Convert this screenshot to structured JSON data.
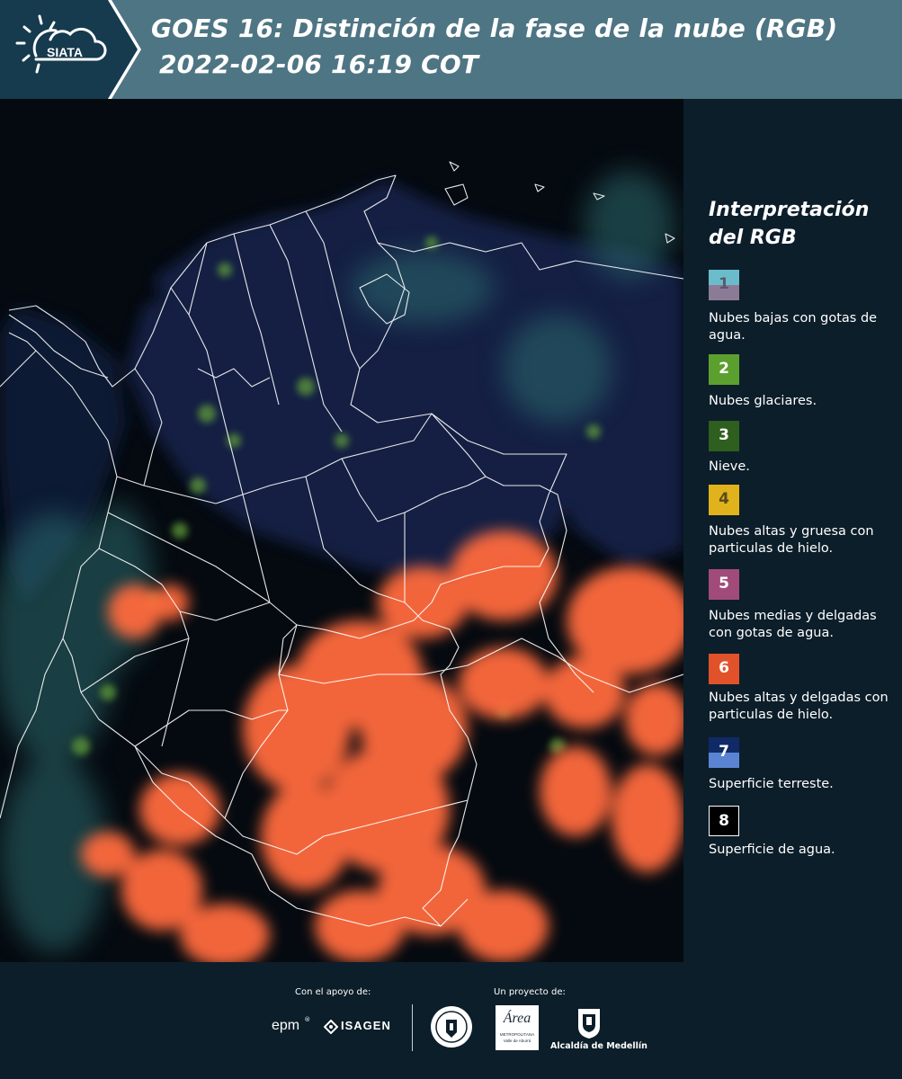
{
  "header": {
    "logo_text": "SIATA",
    "title": "GOES 16: Distinción de la fase de la nube (RGB)",
    "subtitle": "2022-02-06 16:19 COT"
  },
  "legend": {
    "title_line1": "Interpretación",
    "title_line2": "del RGB",
    "items": [
      {
        "number": "1",
        "label_line1": "",
        "label_line2": "",
        "label": "Nubes bajas con gotas de agua.",
        "color_top": "#6bbccb",
        "color_bottom": "#8c7b96"
      },
      {
        "number": "2",
        "label": "Nubes glaciares.",
        "color": "#5ba02e"
      },
      {
        "number": "3",
        "label": "Nieve.",
        "color": "#2f5f1e"
      },
      {
        "number": "4",
        "label": "Nubes altas y gruesa con particulas de hielo.",
        "color": "#e0b31c"
      },
      {
        "number": "5",
        "label": "Nubes medias y delgadas con gotas de agua.",
        "color": "#a14b7a"
      },
      {
        "number": "6",
        "label": "Nubes altas y delgadas con particulas de hielo.",
        "color": "#e2522a"
      },
      {
        "number": "7",
        "label": "Superficie terreste.",
        "color_top": "#0f2a66",
        "color_bottom": "#5a84d3"
      },
      {
        "number": "8",
        "label": "Superficie de agua.",
        "color": "#000000"
      }
    ]
  },
  "footer": {
    "support_caption": "Con el apoyo de:",
    "project_caption": "Un proyecto de:",
    "sponsors": [
      "epm",
      "ISAGEN"
    ],
    "partners": [
      "Área Metropolitana Valle de Aburrá",
      "Alcaldía de Medellín"
    ],
    "area_logo_text": "Área",
    "area_logo_sub1": "METROPOLITANA",
    "area_logo_sub2": "Valle de Aburrá",
    "alcaldia_text": "Alcaldía de Medellín"
  },
  "colors": {
    "header_bg": "#4e7583",
    "panel_bg": "#0c1e2a",
    "map_bg": "#050a10",
    "cloud_orange": "#ff6a3d",
    "borders": "#ffffff"
  },
  "icons": [
    "sun-cloud-logo-icon",
    "epm-logo-icon",
    "isagen-logo-icon",
    "area-metropolitana-logo-icon",
    "alcaldia-medellin-logo-icon",
    "seal-logo-icon"
  ]
}
